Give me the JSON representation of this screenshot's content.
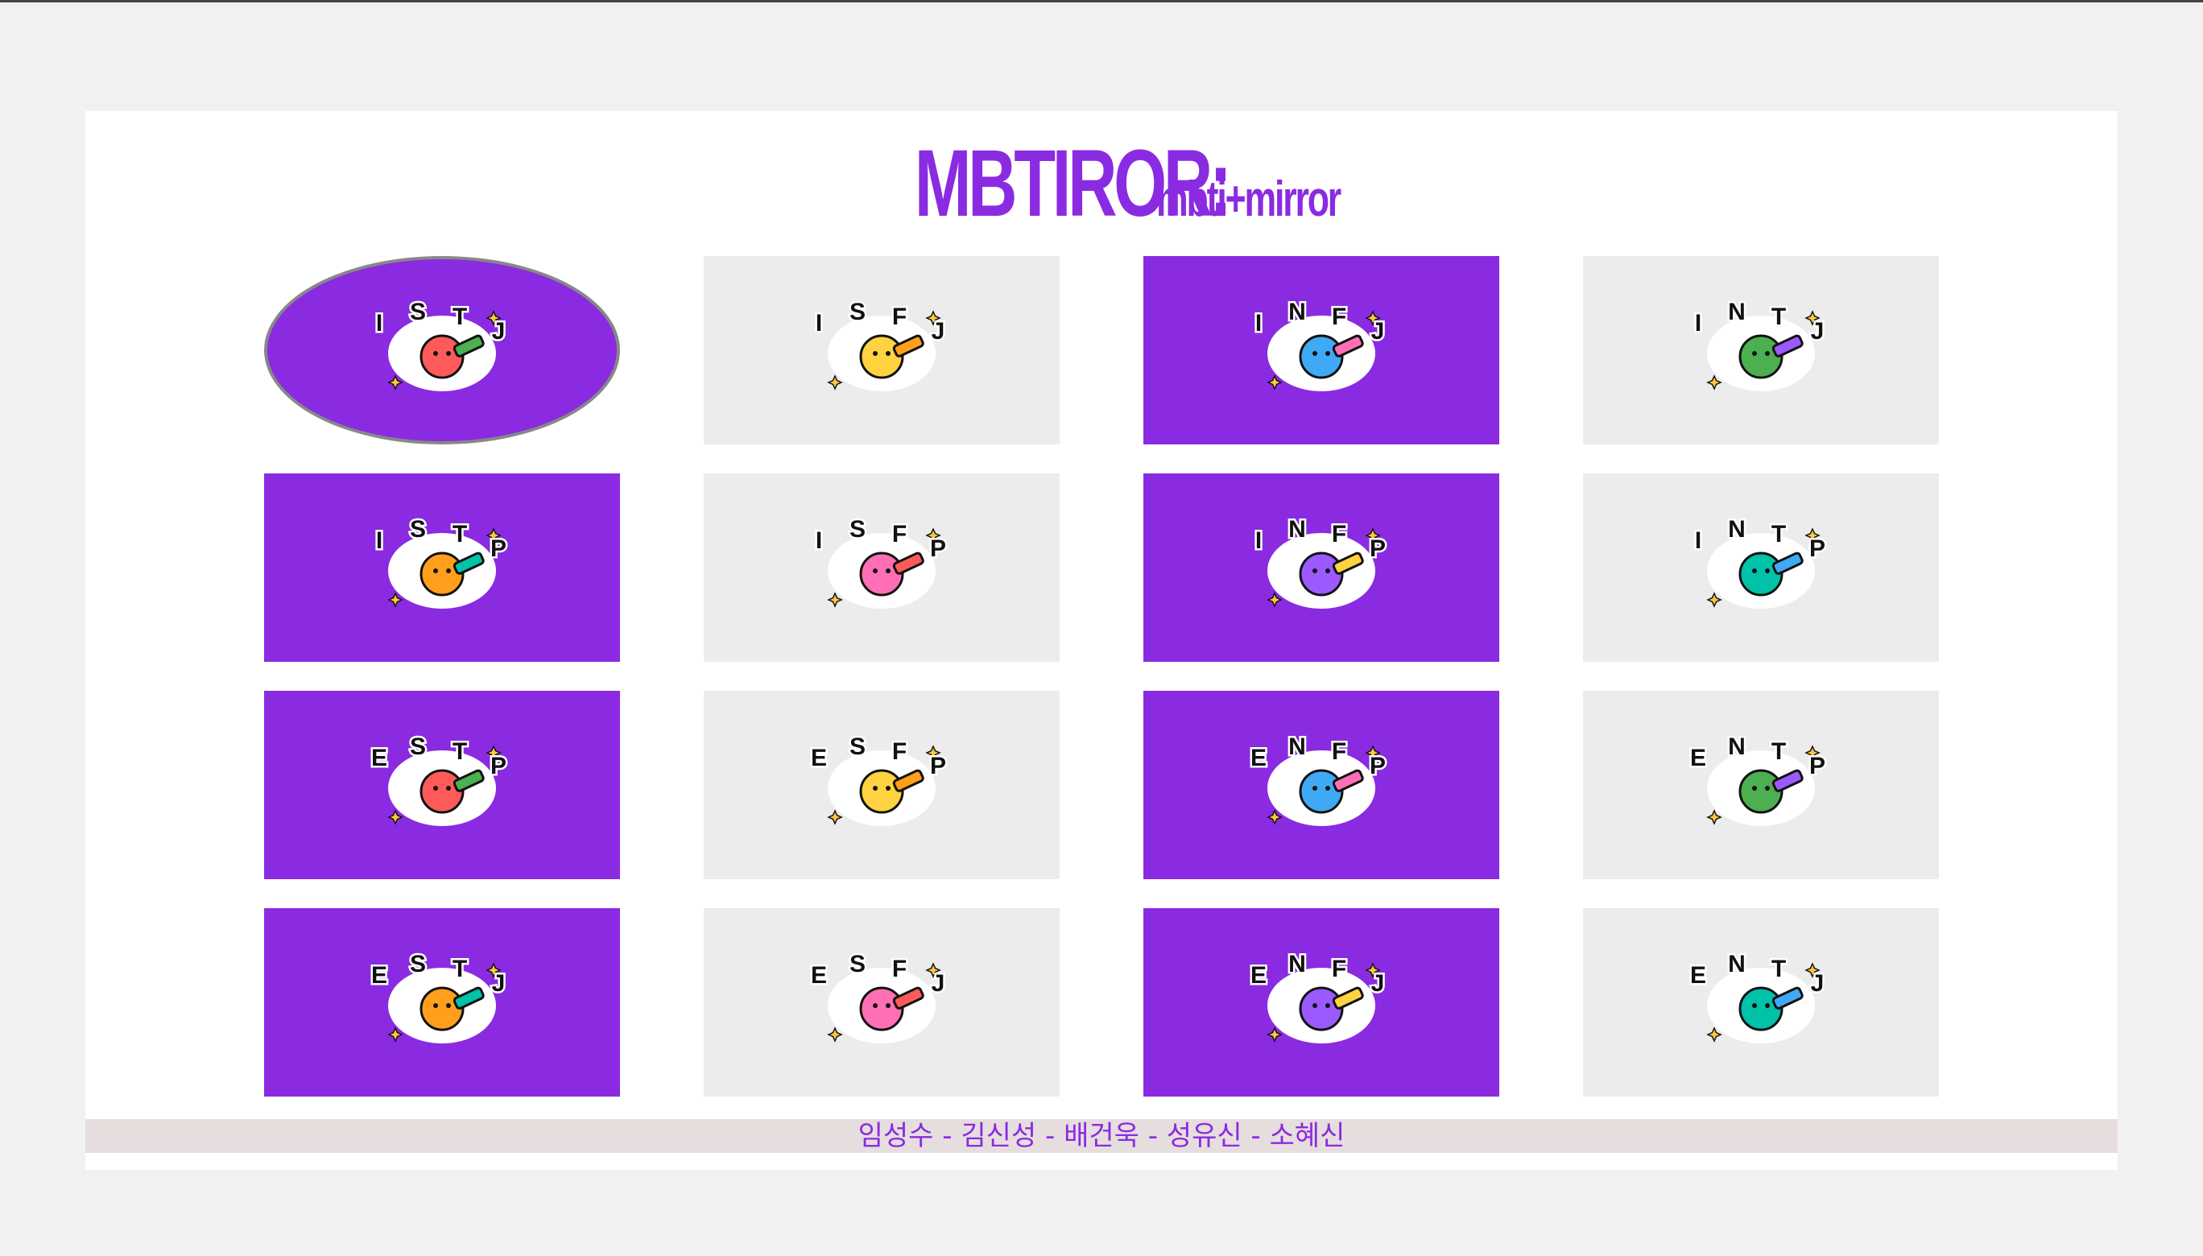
{
  "header": {
    "title_main": "MBTIROR:",
    "title_sub": "mbti+mirror"
  },
  "colors": {
    "accent": "#8a2be2",
    "tile_grey": "#ececec",
    "background": "#f1f1f1",
    "footer_bg": "#e6dede"
  },
  "tiles": [
    {
      "type": "ISTJ",
      "icon": "graduation-cap-sticker",
      "bg": "purple",
      "selected": true
    },
    {
      "type": "ISFJ",
      "icon": "sun-sticker",
      "bg": "grey",
      "selected": false
    },
    {
      "type": "INFJ",
      "icon": "bandage-sticker",
      "bg": "purple",
      "selected": false
    },
    {
      "type": "INTJ",
      "icon": "circuit-board-sticker",
      "bg": "grey",
      "selected": false
    },
    {
      "type": "ISTP",
      "icon": "pocket-knife-sticker",
      "bg": "purple",
      "selected": false
    },
    {
      "type": "ISFP",
      "icon": "tea-cup-sticker",
      "bg": "grey",
      "selected": false
    },
    {
      "type": "INFP",
      "icon": "heart-rainbow-sticker",
      "bg": "purple",
      "selected": false
    },
    {
      "type": "INTP",
      "icon": "laptop-sticker",
      "bg": "grey",
      "selected": false
    },
    {
      "type": "ESTP",
      "icon": "sneakers-sticker",
      "bg": "purple",
      "selected": false
    },
    {
      "type": "ESFP",
      "icon": "champagne-sticker",
      "bg": "grey",
      "selected": false
    },
    {
      "type": "ENFP",
      "icon": "party-popper-sticker",
      "bg": "purple",
      "selected": false
    },
    {
      "type": "ENTP",
      "icon": "lightbulb-hand-sticker",
      "bg": "grey",
      "selected": false
    },
    {
      "type": "ESTJ",
      "icon": "ceo-nameplate-sticker",
      "bg": "purple",
      "selected": false
    },
    {
      "type": "ESFJ",
      "icon": "heart-hands-sticker",
      "bg": "grey",
      "selected": false
    },
    {
      "type": "ENFJ",
      "icon": "pencil-sticker",
      "bg": "purple",
      "selected": false
    },
    {
      "type": "ENTJ",
      "icon": "crown-sticker",
      "bg": "grey",
      "selected": false
    }
  ],
  "footer": {
    "credits": "임성수 - 김신성 - 배건욱 - 성유신 - 소혜신"
  }
}
